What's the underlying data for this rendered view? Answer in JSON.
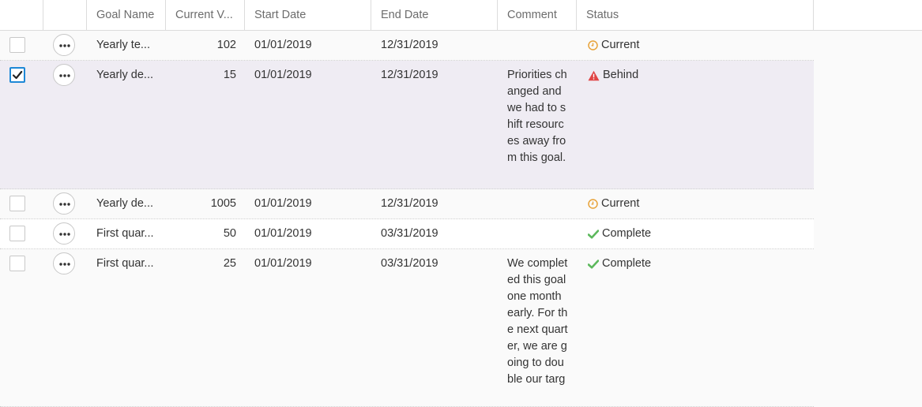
{
  "columns": {
    "goal_name": "Goal Name",
    "current_value": "Current V...",
    "start_date": "Start Date",
    "end_date": "End Date",
    "comment": "Comment",
    "status": "Status"
  },
  "rows": [
    {
      "checked": false,
      "goal_name": "Yearly te...",
      "current_value": "102",
      "start_date": "01/01/2019",
      "end_date": "12/31/2019",
      "comment": "",
      "status": "Current",
      "status_icon": "clock-icon"
    },
    {
      "checked": true,
      "goal_name": "Yearly de...",
      "current_value": "15",
      "start_date": "01/01/2019",
      "end_date": "12/31/2019",
      "comment": "Priorities changed and we had to shift resources away from this goal.",
      "status": "Behind",
      "status_icon": "warning-icon"
    },
    {
      "checked": false,
      "goal_name": "Yearly de...",
      "current_value": "1005",
      "start_date": "01/01/2019",
      "end_date": "12/31/2019",
      "comment": "",
      "status": "Current",
      "status_icon": "clock-icon"
    },
    {
      "checked": false,
      "goal_name": "First quar...",
      "current_value": "50",
      "start_date": "01/01/2019",
      "end_date": "03/31/2019",
      "comment": "",
      "status": "Complete",
      "status_icon": "check-icon"
    },
    {
      "checked": false,
      "goal_name": "First quar...",
      "current_value": "25",
      "start_date": "01/01/2019",
      "end_date": "03/31/2019",
      "comment": "We completed this goal one month early. For the next quarter, we are going to double our targ",
      "status": "Complete",
      "status_icon": "check-icon"
    }
  ],
  "colors": {
    "current": "#e8a33a",
    "behind": "#e04545",
    "complete": "#5cb85c",
    "selected_row": "#efecf3",
    "checkbox_accent": "#1e88d6"
  }
}
